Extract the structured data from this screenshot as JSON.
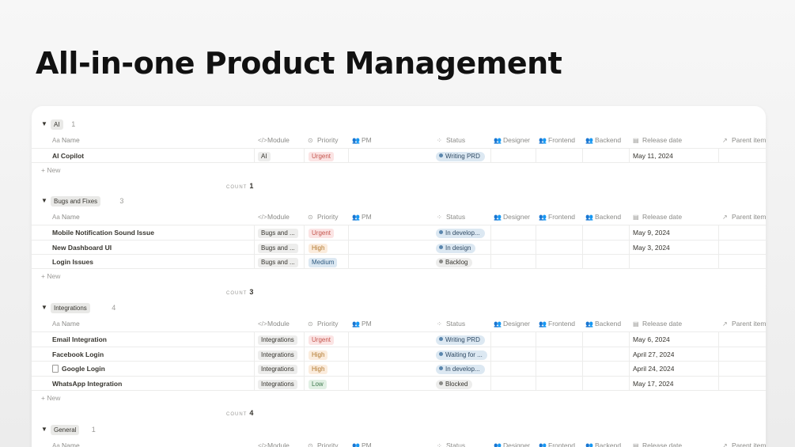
{
  "page": {
    "title": "All-in-one Product Management"
  },
  "columns": [
    {
      "icon": "Aa",
      "icon_name": "text-type-icon",
      "label": "Name"
    },
    {
      "icon": "</>",
      "icon_name": "code-icon",
      "label": "Module"
    },
    {
      "icon": "⊙",
      "icon_name": "target-icon",
      "label": "Priority"
    },
    {
      "icon": "👥",
      "icon_name": "people-icon",
      "label": "PM"
    },
    {
      "icon": "⁘",
      "icon_name": "status-dots-icon",
      "label": "Status"
    },
    {
      "icon": "👥",
      "icon_name": "people-icon",
      "label": "Designer"
    },
    {
      "icon": "👥",
      "icon_name": "people-icon",
      "label": "Frontend"
    },
    {
      "icon": "👥",
      "icon_name": "people-icon",
      "label": "Backend"
    },
    {
      "icon": "▤",
      "icon_name": "calendar-icon",
      "label": "Release date"
    },
    {
      "icon": "↗",
      "icon_name": "arrow-up-right-icon",
      "label": "Parent item"
    }
  ],
  "labels": {
    "new": "+ New",
    "count": "COUNT"
  },
  "groups": [
    {
      "name": "AI",
      "count": "1",
      "rows": [
        {
          "name": "AI Copilot",
          "doc": false,
          "module": "AI",
          "priority": "Urgent",
          "priority_class": "urgent",
          "status": "Writing PRD",
          "status_class": "status-blue",
          "release": "May 11, 2024"
        }
      ]
    },
    {
      "name": "Bugs and Fixes",
      "count": "3",
      "rows": [
        {
          "name": "Mobile Notification Sound Issue",
          "doc": false,
          "module": "Bugs and ...",
          "priority": "Urgent",
          "priority_class": "urgent",
          "status": "In develop...",
          "status_class": "status-blue",
          "release": "May 9, 2024"
        },
        {
          "name": "New Dashboard UI",
          "doc": false,
          "module": "Bugs and ...",
          "priority": "High",
          "priority_class": "high",
          "status": "In design",
          "status_class": "status-blue",
          "release": "May 3, 2024"
        },
        {
          "name": "Login Issues",
          "doc": false,
          "module": "Bugs and ...",
          "priority": "Medium",
          "priority_class": "medium",
          "status": "Backlog",
          "status_class": "status-gray",
          "release": ""
        }
      ]
    },
    {
      "name": "Integrations",
      "count": "4",
      "rows": [
        {
          "name": "Email Integration",
          "doc": false,
          "module": "Integrations",
          "priority": "Urgent",
          "priority_class": "urgent",
          "status": "Writing PRD",
          "status_class": "status-blue",
          "release": "May 6, 2024"
        },
        {
          "name": "Facebook Login",
          "doc": false,
          "module": "Integrations",
          "priority": "High",
          "priority_class": "high",
          "status": "Waiting for ...",
          "status_class": "status-blue",
          "release": "April 27, 2024"
        },
        {
          "name": "Google Login",
          "doc": true,
          "module": "Integrations",
          "priority": "High",
          "priority_class": "high",
          "status": "In develop...",
          "status_class": "status-blue",
          "release": "April 24, 2024"
        },
        {
          "name": "WhatsApp Integration",
          "doc": false,
          "module": "Integrations",
          "priority": "Low",
          "priority_class": "low",
          "status": "Blocked",
          "status_class": "status-gray",
          "release": "May 17, 2024"
        }
      ]
    },
    {
      "name": "General",
      "count": "1",
      "rows": []
    }
  ]
}
